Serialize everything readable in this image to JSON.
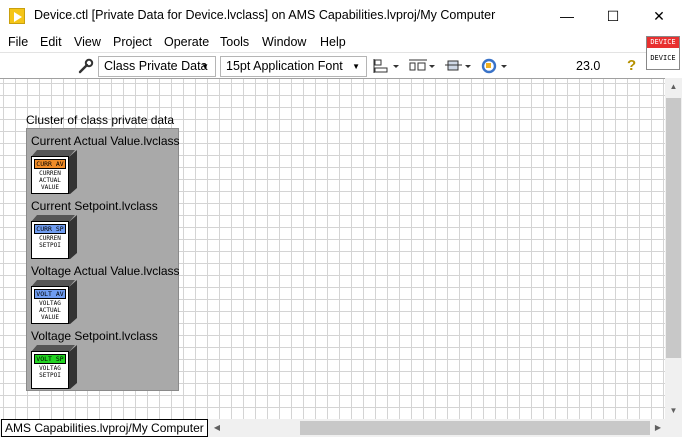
{
  "window": {
    "title": "Device.ctl [Private Data for Device.lvclass] on AMS Capabilities.lvproj/My Computer",
    "minimize": "—",
    "maximize": "☐",
    "close": "✕"
  },
  "menu": [
    "File",
    "Edit",
    "View",
    "Project",
    "Operate",
    "Tools",
    "Window",
    "Help"
  ],
  "vi_icon": {
    "top": "DEVICE",
    "bottom": "DEVICE"
  },
  "toolbar": {
    "class_dropdown": "Class Private Data",
    "font_dropdown": "15pt Application Font",
    "zoom": "23.0",
    "help": "?"
  },
  "canvas": {
    "cluster_label": "Cluster of class private data",
    "elements": [
      {
        "label": "Current Actual Value.lvclass",
        "tag": "CURR AV",
        "tag_color": "#f08c28",
        "text": [
          "CURREN",
          "ACTUAL",
          "VALUE"
        ]
      },
      {
        "label": "Current Setpoint.lvclass",
        "tag": "CURR SP",
        "tag_color": "#6f9cf0",
        "text": [
          "CURREN",
          "SETPOI"
        ]
      },
      {
        "label": "Voltage Actual Value.lvclass",
        "tag": "VOLT AV",
        "tag_color": "#6f9cf0",
        "text": [
          "VOLTAG",
          "ACTUAL",
          "VALUE"
        ]
      },
      {
        "label": "Voltage Setpoint.lvclass",
        "tag": "VOLT SP",
        "tag_color": "#22d422",
        "text": [
          "VOLTAG",
          "SETPOI"
        ]
      }
    ]
  },
  "status": {
    "project_path": "AMS Capabilities.lvproj/My Computer"
  }
}
